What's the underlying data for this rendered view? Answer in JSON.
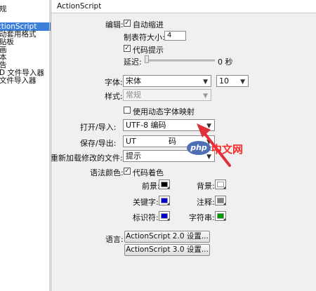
{
  "left_categories": [
    {
      "label": "规",
      "selected": false
    },
    {
      "label": "ctionScript",
      "selected": true
    },
    {
      "label": "动套用格式",
      "selected": false
    },
    {
      "label": "贴板",
      "selected": false
    },
    {
      "label": "画",
      "selected": false
    },
    {
      "label": "本",
      "selected": false
    },
    {
      "label": "告",
      "selected": false
    },
    {
      "label": "D 文件导入器",
      "selected": false
    },
    {
      "label": "文件导入器",
      "selected": false
    }
  ],
  "header": {
    "title": "ActionScript"
  },
  "editing": {
    "label": "编辑:",
    "auto_indent": {
      "label": "自动缩进",
      "checked": true
    },
    "tab_size_label": "制表符大小:",
    "tab_size_value": "4",
    "code_hints": {
      "label": "代码提示",
      "checked": true
    },
    "delay_label": "延迟:",
    "delay_value": "0 秒",
    "delay_level": 0
  },
  "font": {
    "label": "字体:",
    "family": "宋体",
    "size": "10",
    "style_label": "样式:",
    "style_value": "常规",
    "dynamic_mapping": {
      "label": "使用动态字体映射",
      "checked": false
    }
  },
  "encoding": {
    "open_label": "打开/导入:",
    "open_value": "UTF-8 编码",
    "save_label": "保存/导出:",
    "save_value_left": "UT",
    "save_value_right": "码",
    "reload_label": "重新加载修改的文件:",
    "reload_value": "提示"
  },
  "syntax": {
    "label": "语法颜色:",
    "code_coloring": {
      "label": "代码着色",
      "checked": true
    },
    "colors": [
      {
        "label": "前景:",
        "color": "#000000"
      },
      {
        "label": "背景:",
        "color": "#ffffff"
      },
      {
        "label": "关键字:",
        "color": "#0000cc"
      },
      {
        "label": "注释:",
        "color": "#808080"
      },
      {
        "label": "标识符:",
        "color": "#0000cc"
      },
      {
        "label": "字符串:",
        "color": "#009900"
      }
    ]
  },
  "language": {
    "label": "语言:",
    "as2_button": "ActionScript 2.0 设置...",
    "as3_button": "ActionScript 3.0 设置..."
  },
  "watermark": {
    "badge": "php",
    "text": "中文网"
  },
  "colors": {
    "selection": "#3b7fd8",
    "arrow": "#e0303a",
    "panel_bg": "#f0f0f0"
  }
}
